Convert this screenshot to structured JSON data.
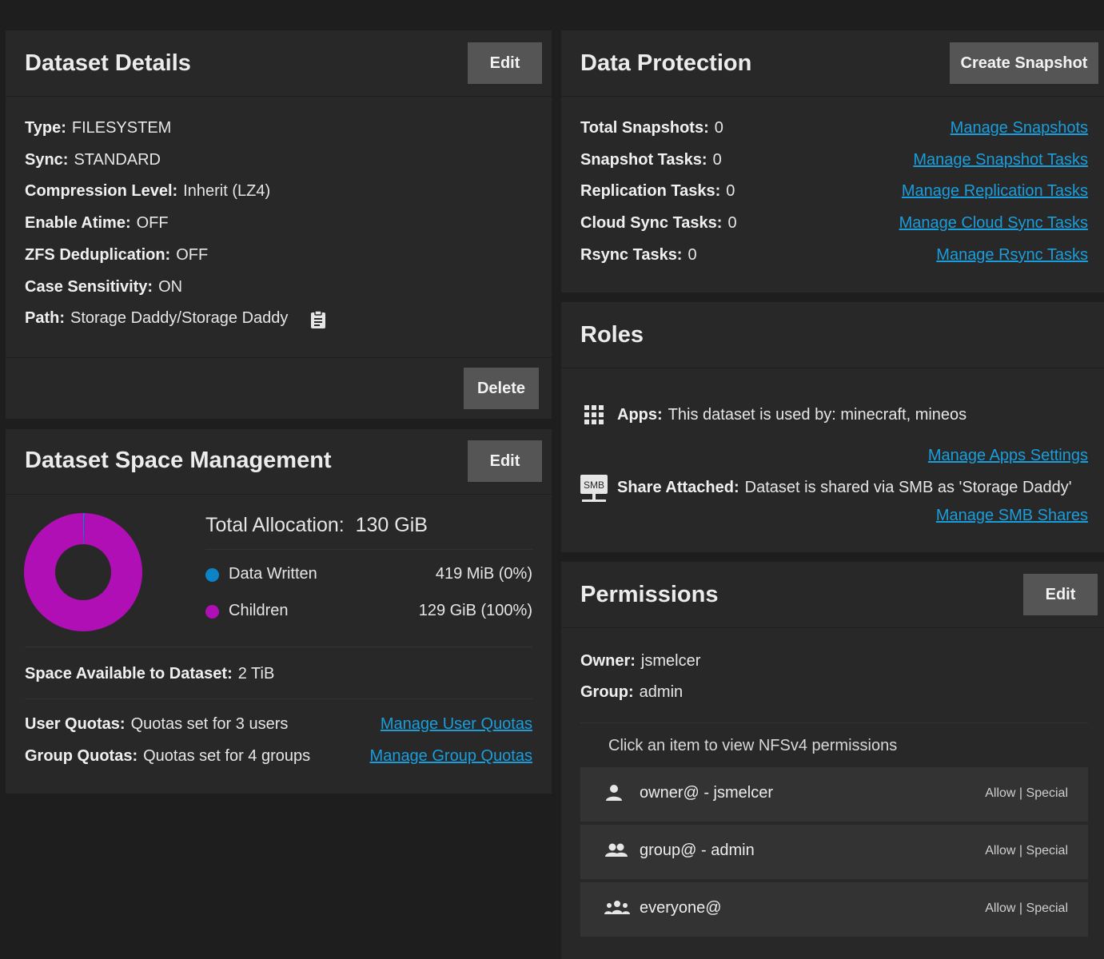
{
  "dataset_details": {
    "title": "Dataset Details",
    "edit_label": "Edit",
    "delete_label": "Delete",
    "fields": [
      {
        "label": "Type:",
        "value": "FILESYSTEM"
      },
      {
        "label": "Sync:",
        "value": "STANDARD"
      },
      {
        "label": "Compression Level:",
        "value": "Inherit (LZ4)"
      },
      {
        "label": "Enable Atime:",
        "value": "OFF"
      },
      {
        "label": "ZFS Deduplication:",
        "value": "OFF"
      },
      {
        "label": "Case Sensitivity:",
        "value": "ON"
      },
      {
        "label": "Path:",
        "value": "Storage Daddy/Storage Daddy"
      }
    ],
    "path_copy_icon": "clipboard-icon"
  },
  "space_management": {
    "title": "Dataset Space Management",
    "edit_label": "Edit",
    "total_label": "Total Allocation:",
    "total_value": "130 GiB",
    "legend": [
      {
        "name": "Data Written",
        "value": "419 MiB (0%)",
        "color": "#0a84c6"
      },
      {
        "name": "Children",
        "value": "129 GiB (100%)",
        "color": "#b00fb6"
      }
    ],
    "available_label": "Space Available to Dataset:",
    "available_value": "2 TiB",
    "user_quotas_label": "User Quotas:",
    "user_quotas_value": "Quotas set for 3 users",
    "user_quotas_link": "Manage User Quotas",
    "group_quotas_label": "Group Quotas:",
    "group_quotas_value": "Quotas set for 4 groups",
    "group_quotas_link": "Manage Group Quotas"
  },
  "chart_data": {
    "type": "pie",
    "categories": [
      "Data Written",
      "Children"
    ],
    "values": [
      0.419,
      129
    ],
    "colors": [
      "#0a84c6",
      "#b00fb6"
    ]
  },
  "data_protection": {
    "title": "Data Protection",
    "create_snapshot_label": "Create Snapshot",
    "rows": [
      {
        "label": "Total Snapshots:",
        "value": "0",
        "link": "Manage Snapshots"
      },
      {
        "label": "Snapshot Tasks:",
        "value": "0",
        "link": "Manage Snapshot Tasks"
      },
      {
        "label": "Replication Tasks:",
        "value": "0",
        "link": "Manage Replication Tasks"
      },
      {
        "label": "Cloud Sync Tasks:",
        "value": "0",
        "link": "Manage Cloud Sync Tasks"
      },
      {
        "label": "Rsync Tasks:",
        "value": "0",
        "link": "Manage Rsync Tasks"
      }
    ]
  },
  "roles": {
    "title": "Roles",
    "apps_label": "Apps:",
    "apps_value": "This dataset is used by: minecraft, mineos",
    "apps_link": "Manage Apps Settings",
    "share_icon_text": "SMB",
    "share_label": "Share Attached:",
    "share_value": "Dataset is shared via SMB as 'Storage Daddy'",
    "share_link": "Manage SMB Shares"
  },
  "permissions": {
    "title": "Permissions",
    "edit_label": "Edit",
    "owner_label": "Owner:",
    "owner_value": "jsmelcer",
    "group_label": "Group:",
    "group_value": "admin",
    "hint": "Click an item to view NFSv4 permissions",
    "items": [
      {
        "name": "owner@ - jsmelcer",
        "tag": "Allow | Special",
        "icon": "person-icon"
      },
      {
        "name": "group@ - admin",
        "tag": "Allow | Special",
        "icon": "group-icon"
      },
      {
        "name": "everyone@",
        "tag": "Allow | Special",
        "icon": "everyone-icon"
      }
    ]
  }
}
